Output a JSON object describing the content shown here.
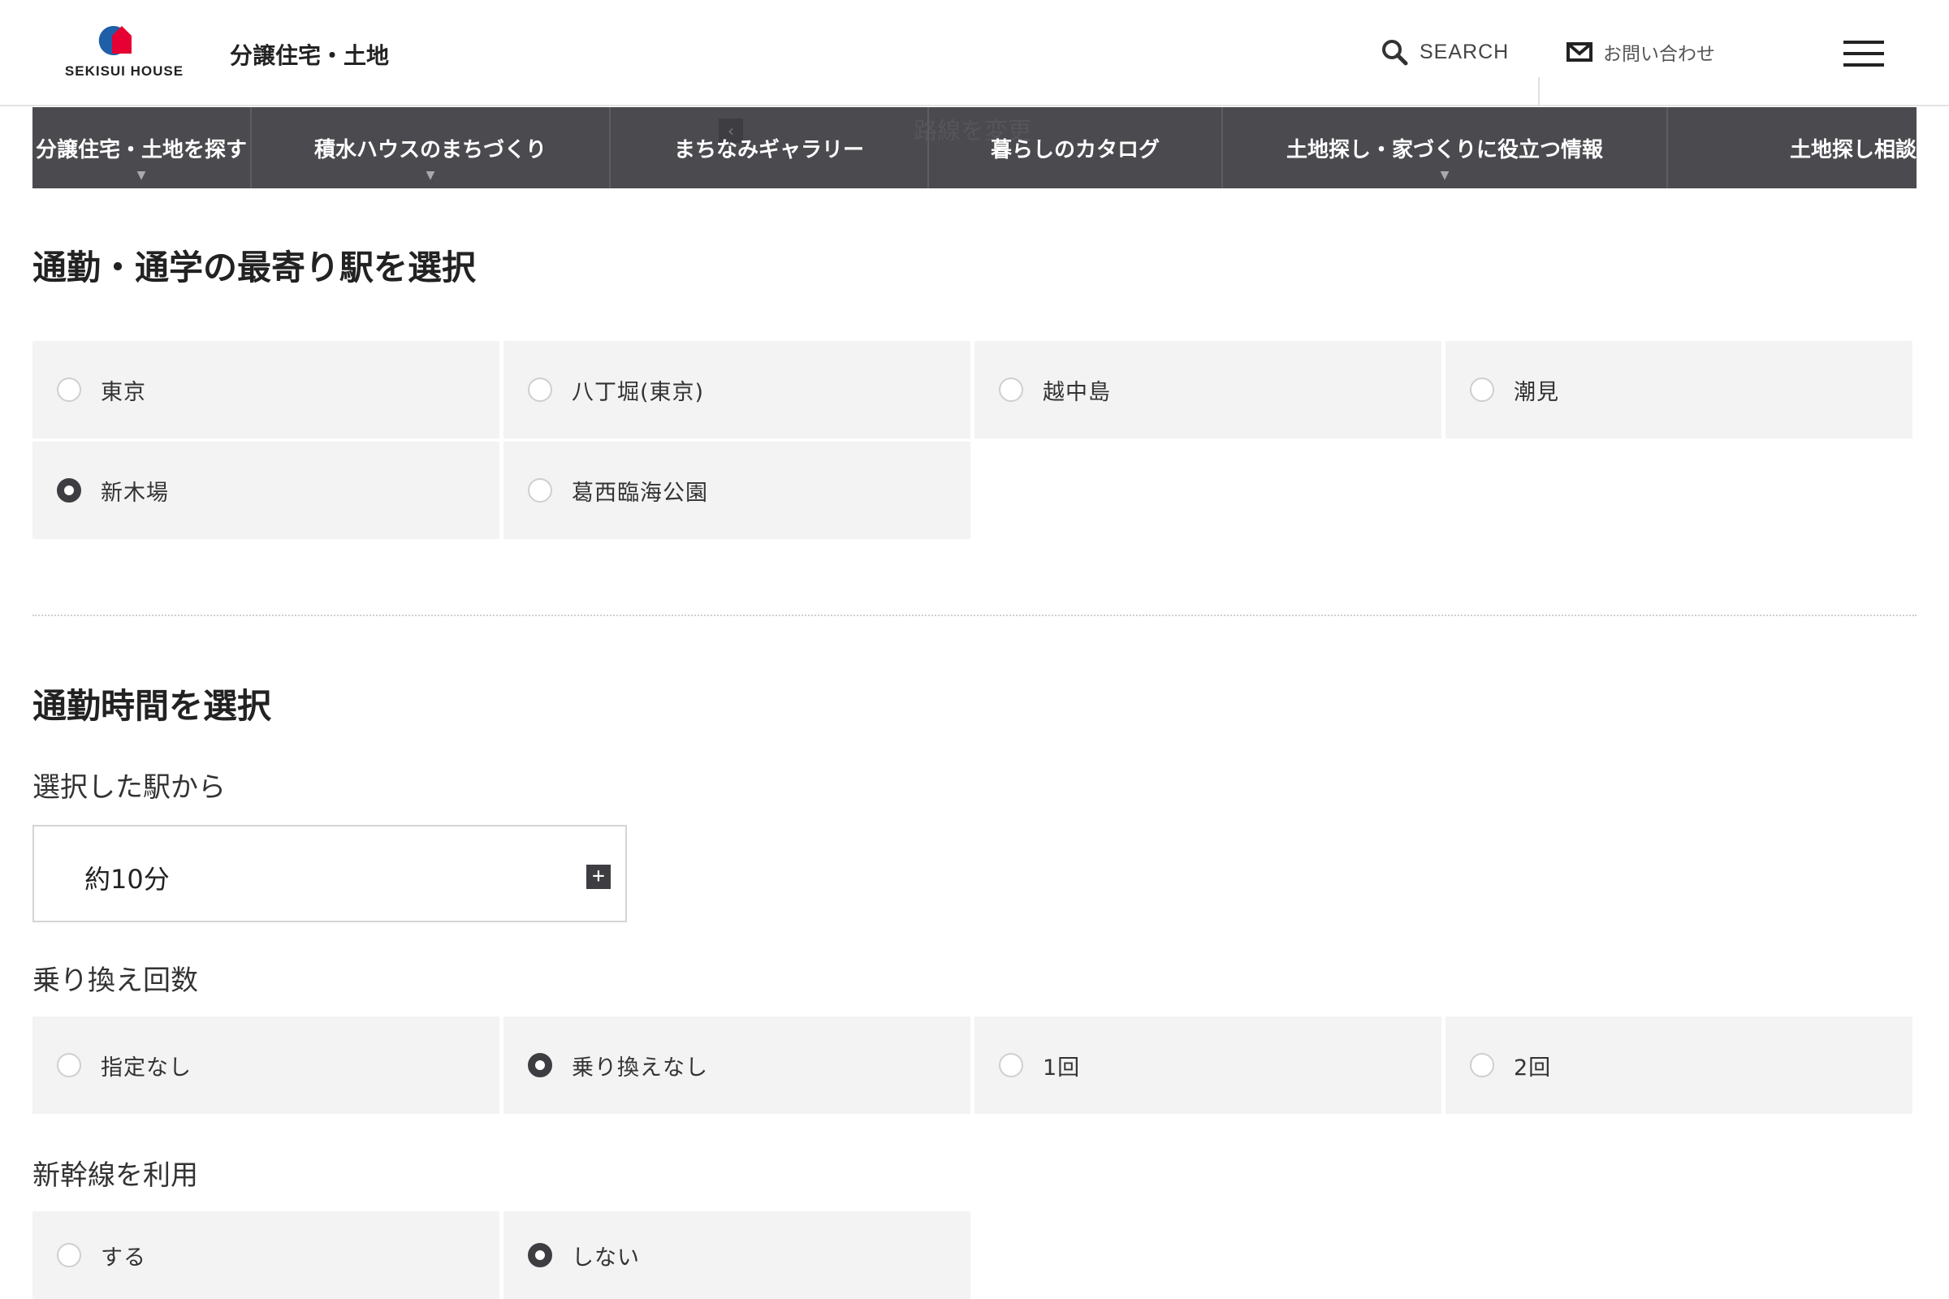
{
  "header": {
    "logo_text": "SEKISUI HOUSE",
    "site_title": "分譲住宅・土地",
    "search_label": "SEARCH",
    "contact_label": "お問い合わせ"
  },
  "nav": {
    "items": [
      {
        "label": "分譲住宅・土地を探す",
        "has_dropdown": "▼"
      },
      {
        "label": "積水ハウスのまちづくり",
        "has_dropdown": "▼"
      },
      {
        "label": "まちなみギャラリー"
      },
      {
        "label": "暮らしのカタログ"
      },
      {
        "label": "土地探し・家づくりに役立つ情報",
        "has_dropdown": "▼"
      },
      {
        "label": "土地探し相談"
      }
    ],
    "ghost_text": "路線を変更"
  },
  "station_section": {
    "heading": "通勤・通学の最寄り駅を選択",
    "options": [
      {
        "label": "東京",
        "checked": false
      },
      {
        "label": "八丁堀(東京)",
        "checked": false
      },
      {
        "label": "越中島",
        "checked": false
      },
      {
        "label": "潮見",
        "checked": false
      },
      {
        "label": "新木場",
        "checked": true
      },
      {
        "label": "葛西臨海公園",
        "checked": false
      }
    ]
  },
  "commute_section": {
    "heading": "通勤時間を選択",
    "from_label": "選択した駅から",
    "time_value": "約10分",
    "transfer_label": "乗り換え回数",
    "transfer_options": [
      {
        "label": "指定なし",
        "checked": false
      },
      {
        "label": "乗り換えなし",
        "checked": true
      },
      {
        "label": "1回",
        "checked": false
      },
      {
        "label": "2回",
        "checked": false
      }
    ],
    "shinkansen_label": "新幹線を利用",
    "shinkansen_options": [
      {
        "label": "する",
        "checked": false
      },
      {
        "label": "しない",
        "checked": true
      }
    ]
  },
  "colors": {
    "nav_bg": "#4a4a4f",
    "option_bg": "#f3f3f3",
    "logo_blue": "#1f5fa8",
    "logo_red": "#e60033"
  }
}
